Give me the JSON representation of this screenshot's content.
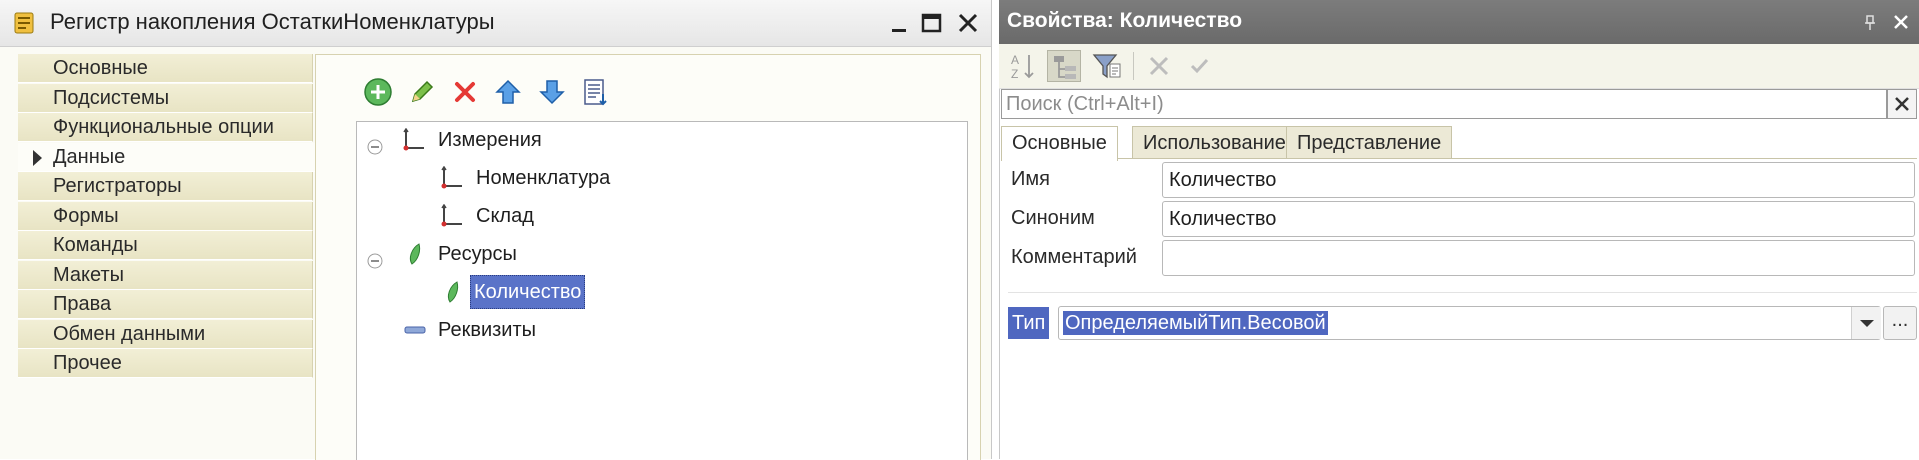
{
  "left_window": {
    "title": "Регистр накопления ОстаткиНоменклатуры",
    "icons": {
      "window": "register-icon",
      "minimize": "minimize-icon",
      "maximize": "maximize-icon",
      "close": "close-icon"
    }
  },
  "nav": {
    "items": [
      {
        "label": "Основные"
      },
      {
        "label": "Подсистемы"
      },
      {
        "label": "Функциональные опции"
      },
      {
        "label": "Данные",
        "active": true
      },
      {
        "label": "Регистраторы"
      },
      {
        "label": "Формы"
      },
      {
        "label": "Команды"
      },
      {
        "label": "Макеты"
      },
      {
        "label": "Права"
      },
      {
        "label": "Обмен данными"
      },
      {
        "label": "Прочее"
      }
    ]
  },
  "toolbar": {
    "icons": [
      "add-icon",
      "edit-icon",
      "delete-icon",
      "move-up-icon",
      "move-down-icon",
      "sort-list-icon"
    ]
  },
  "tree": {
    "dimensions": {
      "label": "Измерения",
      "icon": "dimension-icon",
      "expanded": true
    },
    "dimension_items": [
      {
        "label": "Номенклатура"
      },
      {
        "label": "Склад"
      }
    ],
    "resources": {
      "label": "Ресурсы",
      "icon": "resource-icon",
      "expanded": true
    },
    "resource_items": [
      {
        "label": "Количество",
        "selected": true
      }
    ],
    "attributes": {
      "label": "Реквизиты",
      "icon": "attribute-icon"
    }
  },
  "properties": {
    "title": "Свойства: Количество",
    "icons": {
      "pin": "pin-icon",
      "close": "close-icon"
    },
    "toolbar_icons": [
      "sort-alphabet-icon",
      "categorized-icon",
      "filter-icon",
      "cancel-icon",
      "apply-icon"
    ],
    "search": {
      "placeholder": "Поиск (Ctrl+Alt+I)",
      "value": ""
    },
    "tabs": [
      {
        "label": "Основные",
        "active": true
      },
      {
        "label": "Использование"
      },
      {
        "label": "Представление"
      }
    ],
    "fields": {
      "name": {
        "label": "Имя",
        "value": "Количество"
      },
      "synonym": {
        "label": "Синоним",
        "value": "Количество"
      },
      "comment": {
        "label": "Комментарий",
        "value": ""
      },
      "type": {
        "label": "Тип",
        "value": "ОпределяемыйТип.Весовой",
        "more": "..."
      }
    }
  },
  "colors": {
    "selection": "#5a73c8",
    "nav_bg": "#ece8cc",
    "properties_header": "#717171"
  }
}
